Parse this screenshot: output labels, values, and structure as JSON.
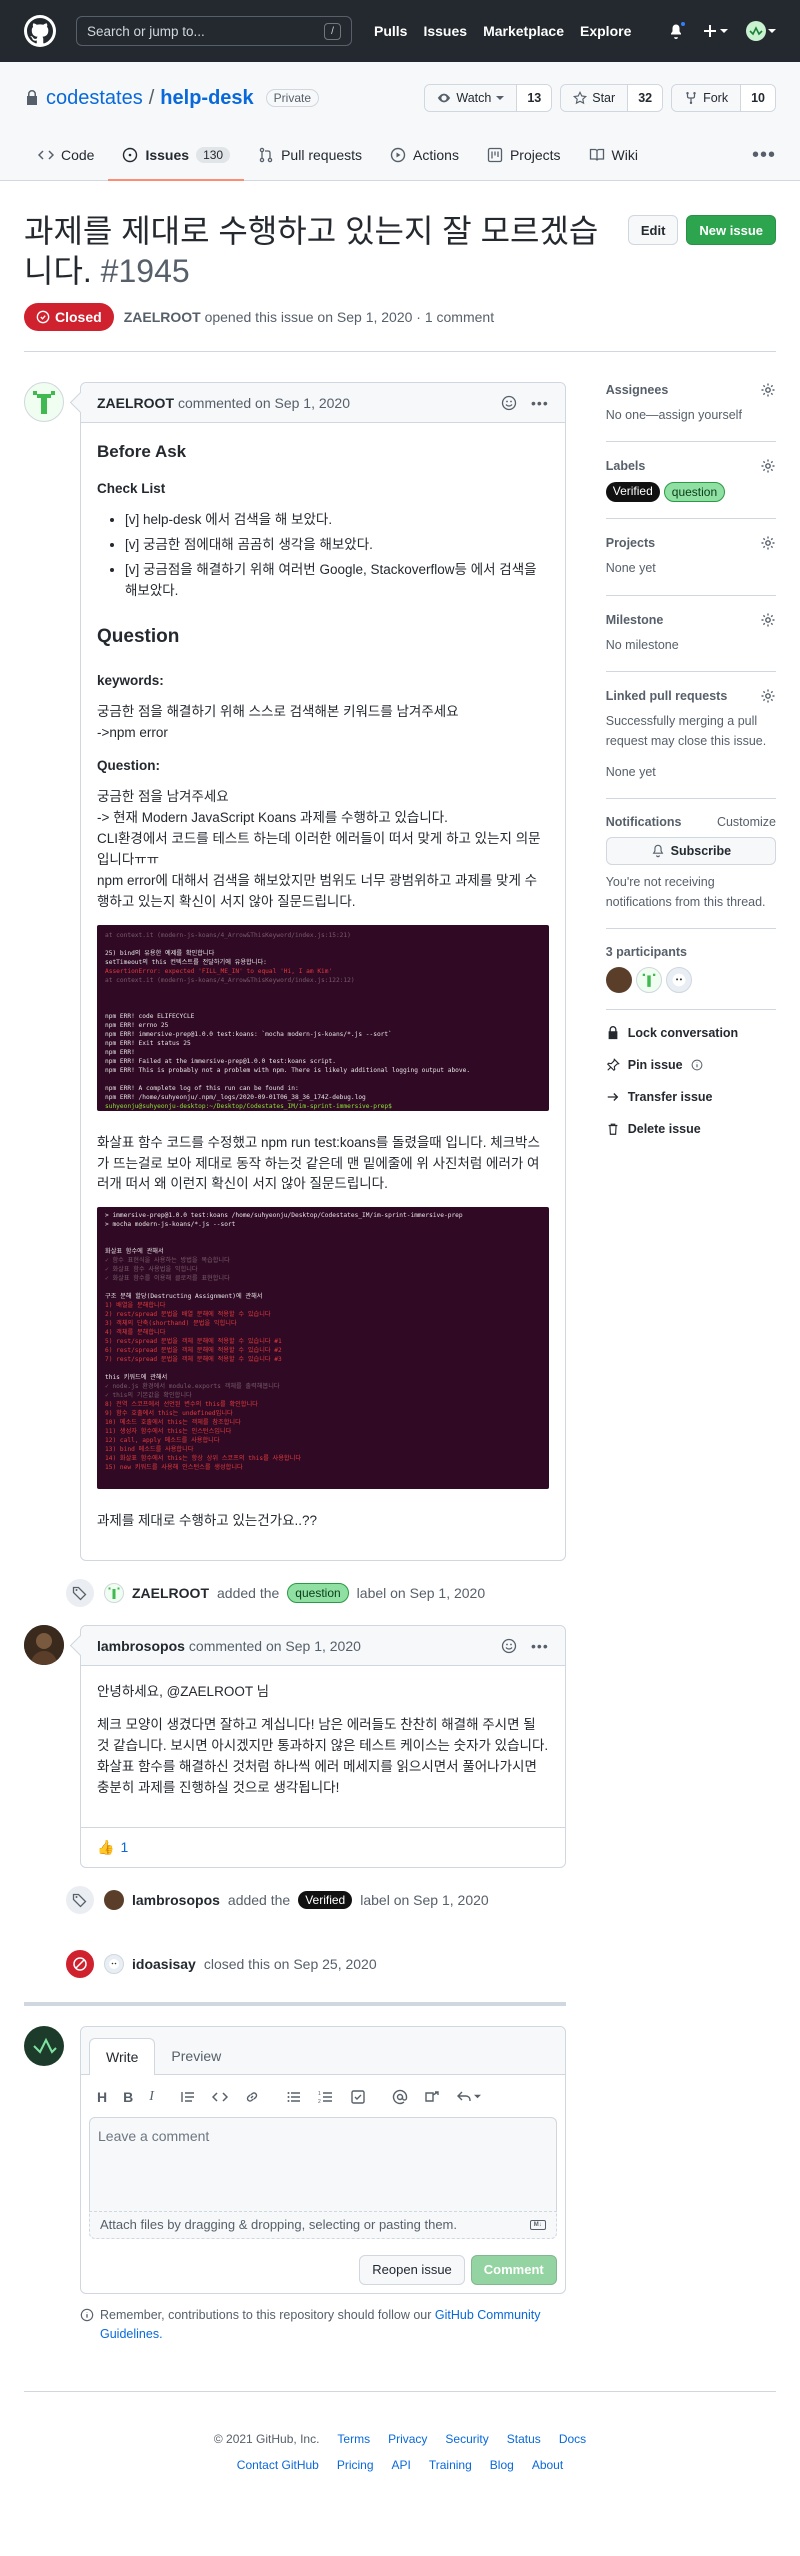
{
  "header": {
    "search_placeholder": "Search or jump to...",
    "search_shortcut": "/",
    "nav": [
      "Pulls",
      "Issues",
      "Marketplace",
      "Explore"
    ]
  },
  "repo": {
    "owner": "codestates",
    "name": "help-desk",
    "visibility": "Private",
    "watch_label": "Watch",
    "watch_count": "13",
    "star_label": "Star",
    "star_count": "32",
    "fork_label": "Fork",
    "fork_count": "10",
    "tabs": [
      {
        "label": "Code"
      },
      {
        "label": "Issues",
        "count": "130"
      },
      {
        "label": "Pull requests"
      },
      {
        "label": "Actions"
      },
      {
        "label": "Projects"
      },
      {
        "label": "Wiki"
      }
    ]
  },
  "issue": {
    "title": "과제를 제대로 수행하고 있는지 잘 모르겠습니다.",
    "number": "#1945",
    "edit_label": "Edit",
    "new_issue_label": "New issue",
    "state": "Closed",
    "author": "ZAELROOT",
    "meta_text": "opened this issue on Sep 1, 2020 · 1 comment"
  },
  "first_comment": {
    "author": "ZAELROOT",
    "date_text": "commented on Sep 1, 2020",
    "h_before": "Before Ask",
    "h_checklist": "Check List",
    "checklist": [
      "[v] help-desk 에서 검색을 해 보았다.",
      "[v] 궁금한 점에대해 곰곰히 생각을 해보았다.",
      "[v] 궁금점을 해결하기 위해 여러번 Google, Stackoverflow등 에서 검색을 해보았다."
    ],
    "h_question": "Question",
    "h_keywords": "keywords:",
    "keywords_lines": [
      "궁금한 점을 해결하기 위해 스스로 검색해본 키워드를 남겨주세요",
      "->npm error"
    ],
    "h_question2": "Question:",
    "question_lines": [
      "궁금한 점을 남겨주세요",
      "-> 현재 Modern JavaScript Koans 과제를 수행하고 있습니다.",
      "CLI환경에서 코드를 테스트 하는데 이러한 에러들이 떠서 맞게 하고 있는지 의문입니다ㅠㅠ",
      "npm error에 대해서 검색을 해보았지만 범위도 너무 광범위하고 과제를 맞게 수행하고 있는지 확신이 서지 않아 질문드립니다."
    ],
    "terminal1": [
      "   at context.it (modern-js-koans/4_Arrow&ThisKeyword/index.js:15:21)",
      "",
      "25) bind의 유용한 예제를 확인합니다",
      "     setTimeout의 this 컨텍스트를 전달하기에 유용합니다:",
      "   AssertionError: expected 'FILL_ME_IN' to equal 'Hi, I am Kim'",
      "   at context.it (modern-js-koans/4_Arrow&ThisKeyword/index.js:122:12)",
      "",
      "",
      "",
      "npm ERR! code ELIFECYCLE",
      "npm ERR! errno 25",
      "npm ERR! immersive-prep@1.0.0 test:koans: `mocha modern-js-koans/*.js --sort`",
      "npm ERR! Exit status 25",
      "npm ERR!",
      "npm ERR! Failed at the immersive-prep@1.0.0 test:koans script.",
      "npm ERR! This is probably not a problem with npm. There is likely additional logging output above.",
      "",
      "npm ERR! A complete log of this run can be found in:",
      "npm ERR!     /home/suhyeonju/.npm/_logs/2020-09-01T06_38_36_174Z-debug.log",
      "suhyeonju@suhyeonju-desktop:~/Desktop/Codestates_IM/im-sprint-immersive-prep$"
    ],
    "middle_text": "화살표 함수 코드를 수정했고 npm run test:koans를 돌렸을때 입니다. 체크박스가 뜨는걸로 보아 제대로 동작 하는것 같은데 맨 밑에줄에 위 사진처럼 에러가 여러개 떠서 왜 이런지 확신이 서지 않아 질문드립니다.",
    "terminal2": [
      "> immersive-prep@1.0.0 test:koans /home/suhyeonju/Desktop/Codestates_IM/im-sprint-immersive-prep",
      "> mocha modern-js-koans/*.js --sort",
      "",
      "",
      "  화살표 함수에 관해서",
      "    ✓ 함수 표현식을 사용하는 방법을 복습합니다",
      "    ✓ 화살표 함수 사용법을 익힙니다",
      "    ✓ 화살표 함수를 이용해 클로저를 표현합니다",
      "",
      "  구조 분해 할당(Destructing Assignment)에 관해서",
      "    1) 배열을 분해합니다",
      "    2) rest/spread 문법을 배열 분해에 적용할 수 있습니다",
      "    3) 객체의 단축(shorthand) 문법을 익힙니다",
      "    4) 객체를 분해합니다",
      "    5) rest/spread 문법을 객체 분해에 적용할 수 있습니다 #1",
      "    6) rest/spread 문법을 객체 분해에 적용할 수 있습니다 #2",
      "    7) rest/spread 문법을 객체 분해에 적용할 수 있습니다 #3",
      "",
      "  this 키워드에 관해서",
      "    ✓ node.js 환경에서 module.exports 객체를 출력해봅니다",
      "    ✓ this의 기본값을 확인합니다",
      "    8) 전역 스코프에서 선언된 변수의 this를 확인합니다",
      "    9) 함수 호출에서 this는 undefined입니다",
      "    10) 메소드 호출에서 this는 객체를 참조합니다",
      "    11) 생성자 함수에서 this는 인스턴스입니다",
      "    12) call, apply 메소드를 사용합니다",
      "    13) bind 메소드를 사용합니다",
      "    14) 화살표 함수에서 this는 항상 상위 스코프의 this를 사용합니다",
      "    15) new 키워드를 사용해 인스턴스를 생성합니다"
    ],
    "last_line": "과제를 제대로 수행하고 있는건가요..??"
  },
  "event_label_added": {
    "actor": "ZAELROOT",
    "action": "added the",
    "label": "question",
    "suffix": "label on Sep 1, 2020"
  },
  "second_comment": {
    "author": "lambrosopos",
    "date_text": "commented on Sep 1, 2020",
    "greeting": "안녕하세요, @ZAELROOT 님",
    "body": "체크 모양이 생겼다면 잘하고 계십니다! 남은 에러들도 찬찬히 해결해 주시면 될 것 같습니다. 보시면 아시겠지만 통과하지 않은 테스트 케이스는 숫자가 있습니다. 화살표 함수를 해결하신 것처럼 하나씩 에러 메세지를 읽으시면서 풀어나가시면 충분히 과제를 진행하실 것으로 생각됩니다!",
    "reaction_emoji": "👍",
    "reaction_count": "1"
  },
  "event_verified": {
    "actor": "lambrosopos",
    "action": "added the",
    "label": "Verified",
    "suffix": "label on Sep 1, 2020"
  },
  "event_closed": {
    "actor": "idoasisay",
    "text": "closed this on Sep 25, 2020"
  },
  "new_comment": {
    "tab_write": "Write",
    "tab_preview": "Preview",
    "placeholder": "Leave a comment",
    "attach_text": "Attach files by dragging & dropping, selecting or pasting them.",
    "reopen_label": "Reopen issue",
    "comment_label": "Comment",
    "remember_text": "Remember, contributions to this repository should follow our",
    "remember_link": "GitHub Community Guidelines."
  },
  "sidebar": {
    "assignees_title": "Assignees",
    "assignees_value": "No one—assign yourself",
    "labels_title": "Labels",
    "labels": [
      "Verified",
      "question"
    ],
    "projects_title": "Projects",
    "projects_value": "None yet",
    "milestone_title": "Milestone",
    "milestone_value": "No milestone",
    "linked_title": "Linked pull requests",
    "linked_desc": "Successfully merging a pull request may close this issue.",
    "linked_value": "None yet",
    "notifications_title": "Notifications",
    "customize": "Customize",
    "subscribe": "Subscribe",
    "notif_desc": "You're not receiving notifications from this thread.",
    "participants_title": "3 participants",
    "lock": "Lock conversation",
    "pin": "Pin issue",
    "transfer": "Transfer issue",
    "delete": "Delete issue"
  },
  "footer": {
    "copyright": "© 2021 GitHub, Inc.",
    "row1": [
      "Terms",
      "Privacy",
      "Security",
      "Status",
      "Docs"
    ],
    "row2": [
      "Contact GitHub",
      "Pricing",
      "API",
      "Training",
      "Blog",
      "About"
    ]
  },
  "colors": {
    "accent_blue": "#0969da",
    "closed_red": "#cf222e",
    "primary_green": "#2da44e",
    "header_dark": "#24292f",
    "terminal_bg": "#300a24"
  }
}
